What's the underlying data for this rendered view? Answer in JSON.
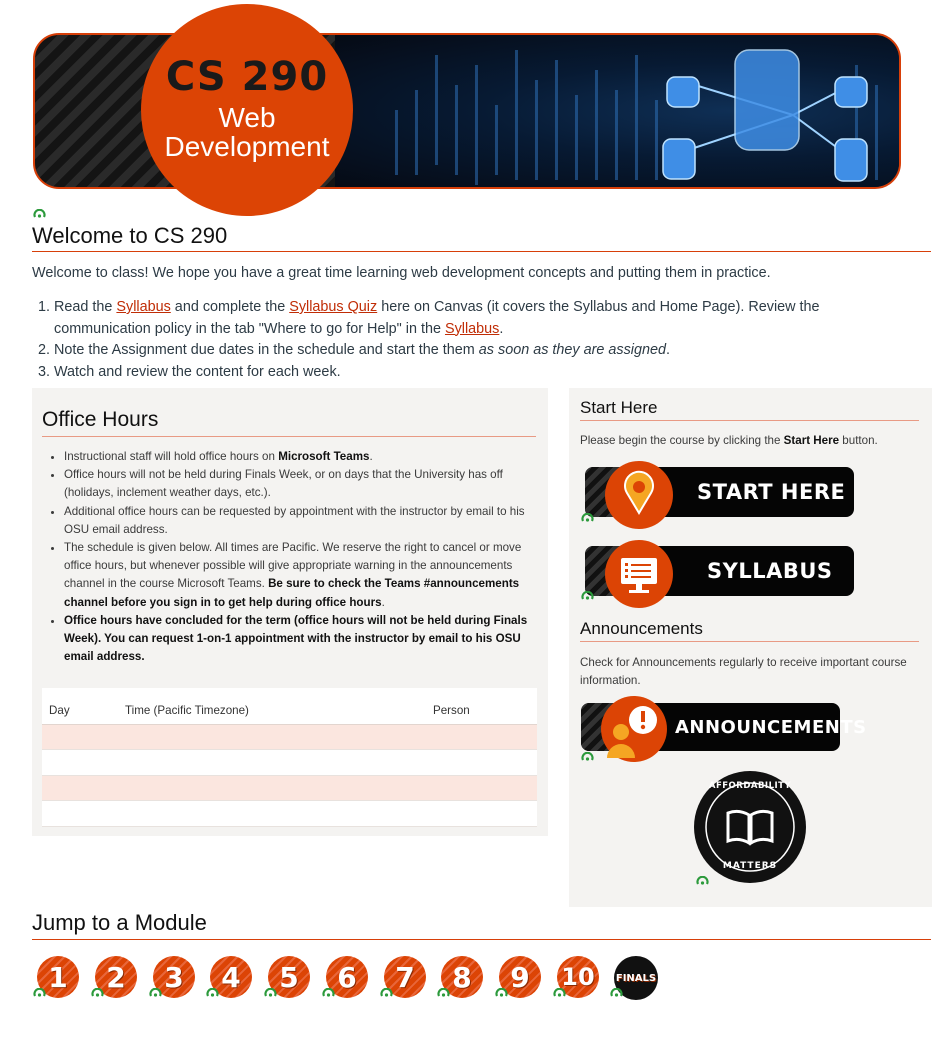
{
  "banner": {
    "code": "CS 290",
    "subtitle_line1": "Web",
    "subtitle_line2": "Development"
  },
  "welcome": {
    "title": "Welcome to CS 290",
    "intro": "Welcome to class! We hope you have a great time learning web development concepts and putting them in practice.",
    "steps": [
      {
        "num": "1.",
        "t1": "Read the ",
        "link1": "Syllabus",
        "t2": " and complete the ",
        "link2": "Syllabus Quiz",
        "t3": " here on Canvas (it covers the Syllabus and Home Page). Review the communication policy in the tab \"Where to go for Help\" in the ",
        "link3": "Syllabus",
        "t4": "."
      },
      {
        "num": "2.",
        "t1": "Note the Assignment due dates in the schedule and start the them ",
        "em": "as soon as they are assigned",
        "t2": "."
      },
      {
        "num": "3.",
        "t1": "Watch and review the content for each week."
      }
    ]
  },
  "office_hours": {
    "title": "Office Hours",
    "bullets": [
      {
        "t1": "Instructional staff will hold office hours on ",
        "b1": "Microsoft Teams",
        "t2": "."
      },
      {
        "t1": "Office hours will not be held during Finals Week, or on days that the University has off (holidays, inclement weather days, etc.)."
      },
      {
        "t1": "Additional office hours can be requested by appointment with the instructor by email to his OSU email address."
      },
      {
        "t1": "The schedule is given below. All times are Pacific. We reserve the right to cancel or move office hours, but whenever possible will give appropriate warning in the announcements channel in the course Microsoft Teams. ",
        "b1": "Be sure to check the Teams #announcements channel before you sign in to get help during office hours",
        "t2": "."
      },
      {
        "b1": "Office hours have concluded for the term (office hours will not be held during Finals Week). You can request 1-on-1 appointment with the instructor by email to his OSU email address."
      }
    ],
    "table": {
      "headers": [
        "Day",
        "Time (Pacific Timezone)",
        "Person"
      ],
      "rows": [
        [
          "",
          "",
          ""
        ],
        [
          "",
          "",
          ""
        ],
        [
          "",
          "",
          ""
        ],
        [
          "",
          "",
          ""
        ]
      ]
    }
  },
  "start_here": {
    "title": "Start Here",
    "text_before": "Please begin the course by clicking the ",
    "text_bold": "Start Here",
    "text_after": " button.",
    "start_button": "START HERE",
    "syllabus_button": "SYLLABUS"
  },
  "announcements": {
    "title": "Announcements",
    "text": "Check for Announcements regularly to receive important course information.",
    "button": "ANNOUNCEMENTS"
  },
  "affordability": {
    "top": "AFFORDABILITY",
    "bottom": "MATTERS"
  },
  "modules": {
    "title": "Jump to a Module",
    "items": [
      "1",
      "2",
      "3",
      "4",
      "5",
      "6",
      "7",
      "8",
      "9",
      "10",
      "FINALS"
    ]
  },
  "colors": {
    "accent": "#dc4405",
    "link": "#c02d06",
    "panel_bg": "#f4f3f1",
    "table_alt": "#fbe6df"
  }
}
